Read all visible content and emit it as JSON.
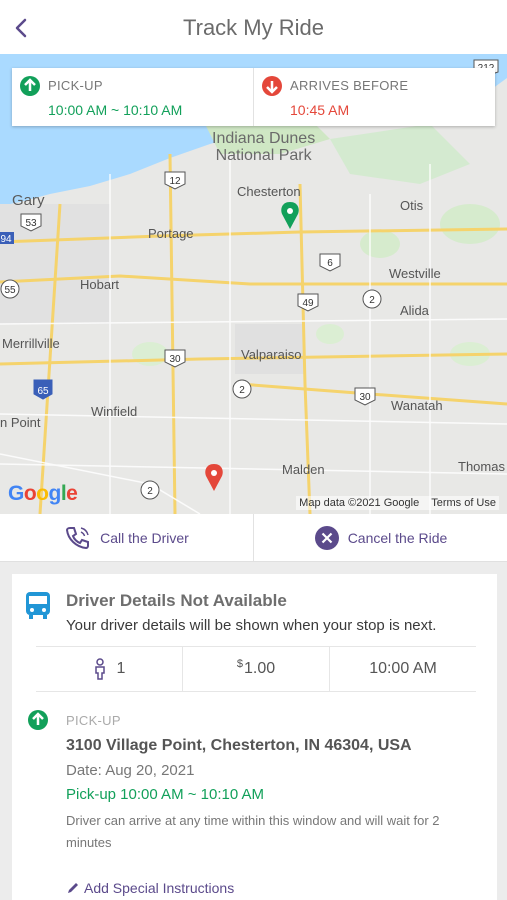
{
  "header": {
    "title": "Track My Ride"
  },
  "ride_summary": {
    "pickup_label": "PICK-UP",
    "pickup_time": "10:00 AM ~ 10:10 AM",
    "arrives_label": "ARRIVES BEFORE",
    "arrives_time": "10:45 AM"
  },
  "map": {
    "places": [
      "Indiana Dunes",
      "National Park",
      "Chesterton",
      "Gary",
      "Otis",
      "Portage",
      "Westville",
      "Hobart",
      "Alida",
      "Merrillville",
      "Valparaiso",
      "Winfield",
      "Wanatah",
      "n Point",
      "Malden",
      "Thomas"
    ],
    "routes": [
      "12",
      "53",
      "94",
      "6",
      "55",
      "2",
      "49",
      "30",
      "65",
      "212"
    ],
    "logo": "Google",
    "attribution": "Map data ©2021 Google",
    "terms": "Terms of Use"
  },
  "actions": {
    "call_label": "Call the Driver",
    "cancel_label": "Cancel the Ride"
  },
  "driver": {
    "title": "Driver Details Not Available",
    "subtitle": "Your driver details will be shown when your stop is next.",
    "passengers": "1",
    "currency": "$",
    "fare": "1.00",
    "time": "10:00 AM"
  },
  "pickup": {
    "label": "PICK-UP",
    "address": "3100 Village Point, Chesterton, IN 46304, USA",
    "date": "Date: Aug 20, 2021",
    "window": "Pick-up 10:00 AM ~ 10:10 AM",
    "note": "Driver can arrive at any time within this window and will wait for 2 minutes",
    "special_label": "Add Special Instructions"
  },
  "colors": {
    "accent": "#5b4a8b",
    "green": "#12a05a",
    "red": "#e4473a",
    "bus": "#2196d6"
  }
}
